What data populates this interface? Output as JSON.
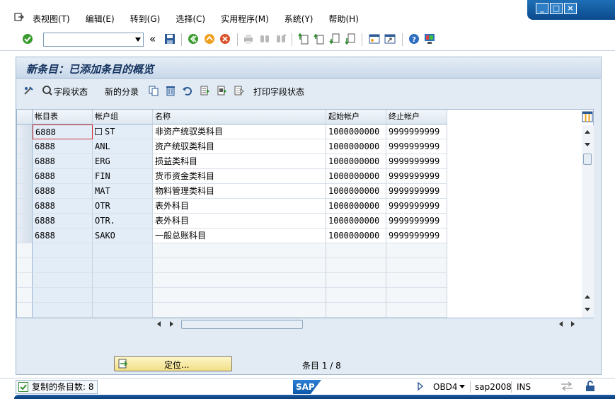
{
  "menu": {
    "items": [
      "表视图(T)",
      "编辑(E)",
      "转到(G)",
      "选择(C)",
      "实用程序(M)",
      "系统(Y)",
      "帮助(H)"
    ]
  },
  "window": {
    "min": "_",
    "max": "□",
    "close": "×"
  },
  "toolbar": {
    "command_value": "",
    "collapse": "«"
  },
  "page": {
    "title": "新条目：已添加条目的概览"
  },
  "app_toolbar": {
    "field_status": "字段状态",
    "new_distribution": "新的分录",
    "print_field_status": "打印字段状态"
  },
  "table": {
    "headers": [
      "帐目表",
      "帐户组",
      "名称",
      "起始帐户",
      "终止帐户"
    ],
    "rows": [
      [
        "6888",
        "ST",
        "非资产统驭类科目",
        "1000000000",
        "9999999999"
      ],
      [
        "6888",
        "ANL",
        "资产统驭类科目",
        "1000000000",
        "9999999999"
      ],
      [
        "6888",
        "ERG",
        "损益类科目",
        "1000000000",
        "9999999999"
      ],
      [
        "6888",
        "FIN",
        "货币资金类科目",
        "1000000000",
        "9999999999"
      ],
      [
        "6888",
        "MAT",
        "物料管理类科目",
        "1000000000",
        "9999999999"
      ],
      [
        "6888",
        "OTR",
        "表外科目",
        "1000000000",
        "9999999999"
      ],
      [
        "6888",
        "OTR.",
        "表外科目",
        "1000000000",
        "9999999999"
      ],
      [
        "6888",
        "SAKO",
        "一般总账科目",
        "1000000000",
        "9999999999"
      ]
    ]
  },
  "footer": {
    "find_button": "定位...",
    "entry_count": "条目 1 / 8"
  },
  "status": {
    "message": "复制的条目数: 8",
    "logo": "SAP",
    "transaction": "OBD4",
    "server": "sap2008",
    "mode": "INS"
  },
  "colors": {
    "accent": "#0a4a8c",
    "title": "#15335f",
    "find_button": "#f2df86"
  }
}
